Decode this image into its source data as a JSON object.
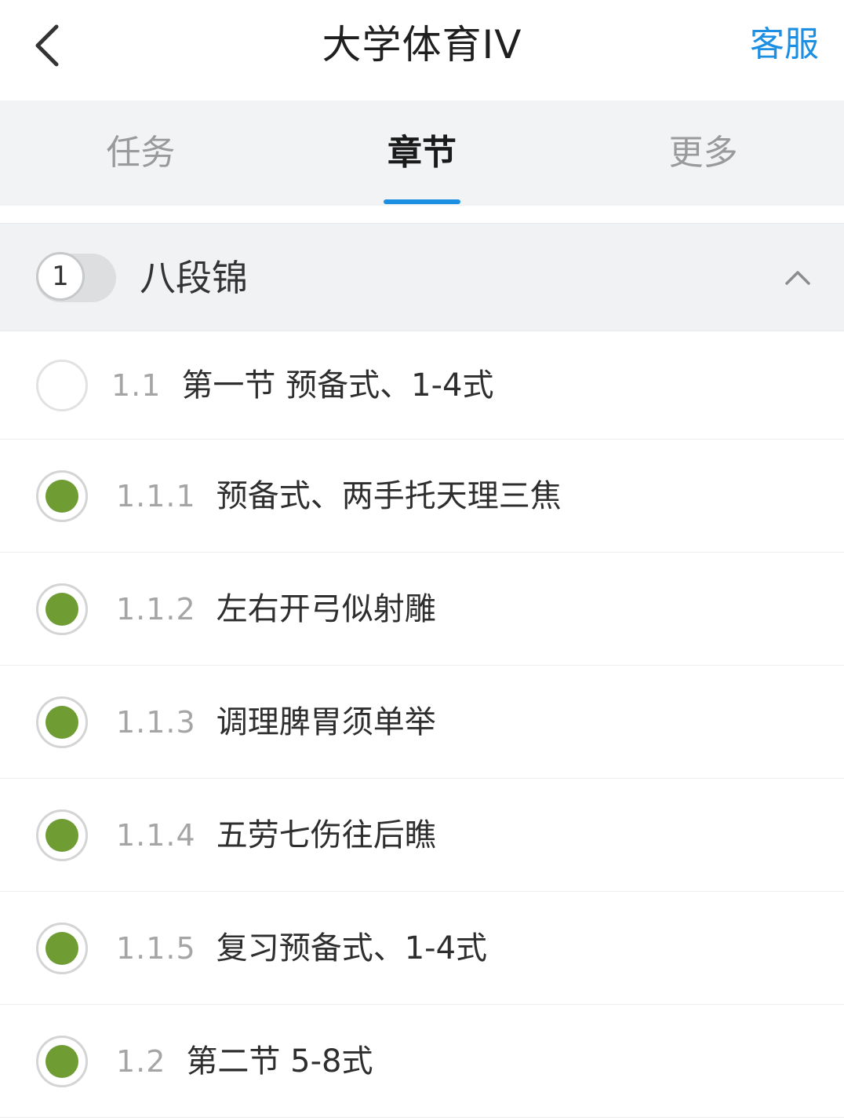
{
  "header": {
    "title": "大学体育IV",
    "service_label": "客服"
  },
  "tabs": [
    {
      "label": "任务",
      "active": false
    },
    {
      "label": "章节",
      "active": true
    },
    {
      "label": "更多",
      "active": false
    }
  ],
  "chapter": {
    "number": "1",
    "title": "八段锦"
  },
  "items": [
    {
      "number": "1.1",
      "label": "第一节 预备式、1-4式",
      "status": "pending"
    },
    {
      "number": "1.1.1",
      "label": "预备式、两手托天理三焦",
      "status": "done"
    },
    {
      "number": "1.1.2",
      "label": "左右开弓似射雕",
      "status": "done"
    },
    {
      "number": "1.1.3",
      "label": "调理脾胃须单举",
      "status": "done"
    },
    {
      "number": "1.1.4",
      "label": "五劳七伤往后瞧",
      "status": "done"
    },
    {
      "number": "1.1.5",
      "label": "复习预备式、1-4式",
      "status": "done"
    },
    {
      "number": "1.2",
      "label": "第二节 5-8式",
      "status": "done"
    }
  ],
  "colors": {
    "accent": "#1d8fe3",
    "done": "#6f9d33"
  },
  "icons": {
    "back": "chevron-left-icon",
    "collapse": "chevron-up-icon"
  }
}
